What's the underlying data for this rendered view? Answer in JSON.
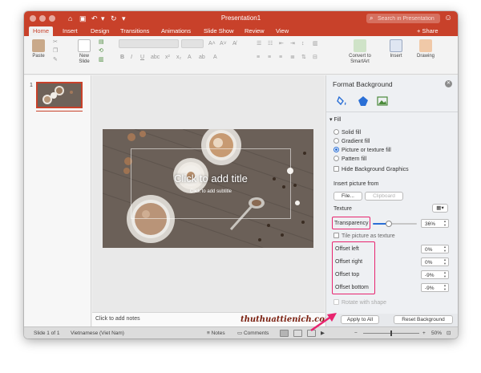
{
  "app": {
    "window_title": "Presentation1",
    "search_placeholder": "Search in Presentation",
    "accent_color": "#c8412a",
    "highlight_color": "#e8246f"
  },
  "tabs": [
    "Home",
    "Insert",
    "Design",
    "Transitions",
    "Animations",
    "Slide Show",
    "Review",
    "View"
  ],
  "share_label": "Share",
  "ribbon": {
    "paste": "Paste",
    "new_slide": "New Slide",
    "convert_smartart": "Convert to SmartArt",
    "insert": "Insert",
    "drawing": "Drawing"
  },
  "thumbnails": {
    "slide_number": "1"
  },
  "slide": {
    "title_placeholder": "Click to add title",
    "subtitle_placeholder": "Click to add subtitle"
  },
  "notes": {
    "placeholder": "Click to add notes",
    "watermark": "thuthuattienich.com"
  },
  "format_pane": {
    "title": "Format Background",
    "fill_header": "Fill",
    "fill_options": [
      "Solid fill",
      "Gradient fill",
      "Picture or texture fill",
      "Pattern fill"
    ],
    "selected_fill": "Picture or texture fill",
    "hide_background_graphics": "Hide Background Graphics",
    "insert_picture_from": "Insert picture from",
    "file_button": "File...",
    "clipboard_button": "Clipboard",
    "texture_label": "Texture",
    "transparency_label": "Transparency",
    "transparency_value": "36%",
    "transparency_fraction": 0.36,
    "tile_picture": "Tile picture as texture",
    "offsets": [
      {
        "label": "Offset left",
        "value": "0%"
      },
      {
        "label": "Offset right",
        "value": "0%"
      },
      {
        "label": "Offset top",
        "value": "-9%"
      },
      {
        "label": "Offset bottom",
        "value": "-9%"
      }
    ],
    "rotate_with_shape": "Rotate with shape",
    "apply_to_all": "Apply to All",
    "reset_background": "Reset Background"
  },
  "status_bar": {
    "slide_counter": "Slide 1 of 1",
    "language": "Vietnamese (Viet Nam)",
    "notes_button": "Notes",
    "comments_button": "Comments",
    "zoom": "50%"
  }
}
